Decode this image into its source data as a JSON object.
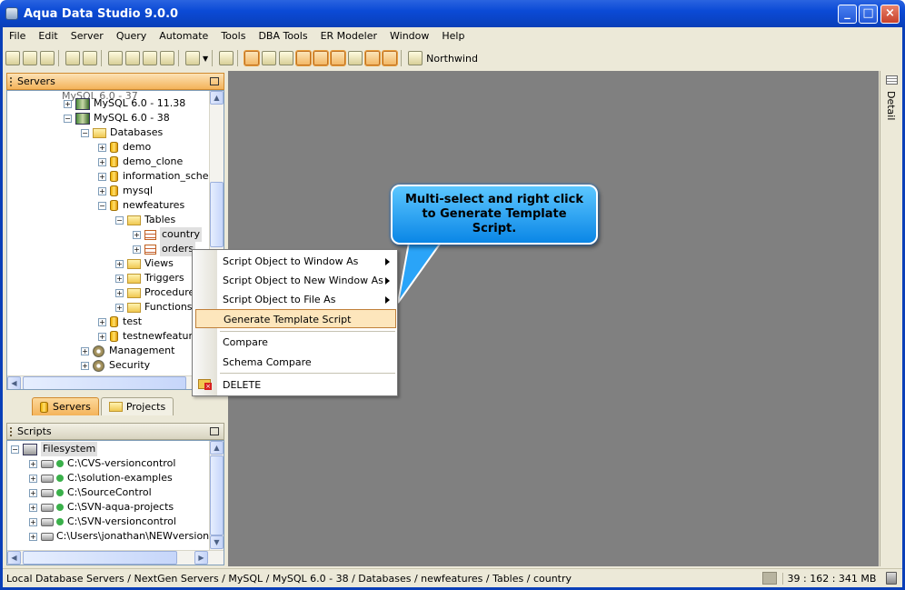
{
  "window": {
    "title": "Aqua Data Studio 9.0.0",
    "minimize": "_",
    "maximize": "□",
    "close": "×"
  },
  "menubar": [
    "File",
    "Edit",
    "Server",
    "Query",
    "Automate",
    "Tools",
    "DBA Tools",
    "ER Modeler",
    "Window",
    "Help"
  ],
  "toolbar": {
    "connection": "Northwind"
  },
  "servers_panel": {
    "title": "Servers",
    "tree": [
      {
        "label": "MySQL 6.0 - 11.38",
        "icon": "server-icon"
      },
      {
        "label": "MySQL 6.0 - 38",
        "icon": "server-icon"
      },
      {
        "label": "Databases",
        "icon": "databases-icon"
      },
      {
        "label": "demo",
        "icon": "database-icon"
      },
      {
        "label": "demo_clone",
        "icon": "database-icon"
      },
      {
        "label": "information_scher",
        "icon": "database-icon"
      },
      {
        "label": "mysql",
        "icon": "database-icon"
      },
      {
        "label": "newfeatures",
        "icon": "database-icon"
      },
      {
        "label": "Tables",
        "icon": "folder-icon"
      },
      {
        "label": "country",
        "icon": "table-icon"
      },
      {
        "label": "orders",
        "icon": "table-icon"
      },
      {
        "label": "Views",
        "icon": "folder-icon"
      },
      {
        "label": "Triggers",
        "icon": "folder-icon"
      },
      {
        "label": "Procedure",
        "icon": "folder-icon"
      },
      {
        "label": "Functions",
        "icon": "folder-icon"
      },
      {
        "label": "test",
        "icon": "database-icon"
      },
      {
        "label": "testnewfeatur",
        "icon": "database-icon"
      },
      {
        "label": "Management",
        "icon": "gear-icon"
      },
      {
        "label": "Security",
        "icon": "lock-icon"
      }
    ],
    "tabs": [
      "Servers",
      "Projects"
    ]
  },
  "scripts_panel": {
    "title": "Scripts",
    "tree": [
      {
        "label": "Filesystem"
      },
      {
        "label": "C:\\CVS-versioncontrol"
      },
      {
        "label": "C:\\solution-examples"
      },
      {
        "label": "C:\\SourceControl"
      },
      {
        "label": "C:\\SVN-aqua-projects"
      },
      {
        "label": "C:\\SVN-versioncontrol"
      },
      {
        "label": "C:\\Users\\jonathan\\NEWversionc"
      }
    ]
  },
  "context_menu": {
    "items": [
      {
        "label": "Script Object to Window As",
        "submenu": true
      },
      {
        "label": "Script Object to New Window As",
        "submenu": true
      },
      {
        "label": "Script Object to File As",
        "submenu": true
      },
      {
        "label": "Generate Template Script",
        "highlighted": true
      },
      {
        "label": "Compare"
      },
      {
        "label": "Schema Compare"
      },
      {
        "label": "DELETE"
      }
    ]
  },
  "callout": {
    "text": "Multi-select and right click to Generate Template Script."
  },
  "right_sidebar": {
    "label": "Detail"
  },
  "statusbar": {
    "path": "Local Database Servers / NextGen Servers / MySQL / MySQL 6.0 - 38 / Databases / newfeatures / Tables / country",
    "memory": "39 : 162 : 341 MB"
  },
  "colors": {
    "workspace": "#808080",
    "title_bar": "#0a4ad6",
    "panel_header": "#f4b35a",
    "callout": "#1a9cf0"
  }
}
